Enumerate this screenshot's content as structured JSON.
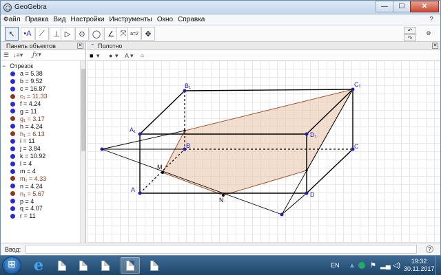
{
  "window": {
    "title": "GeoGebra"
  },
  "window_controls": {
    "minimize": "—",
    "maximize": "☐",
    "close": "✕"
  },
  "menu": [
    "Файл",
    "Правка",
    "Вид",
    "Настройки",
    "Инструменты",
    "Окно",
    "Справка"
  ],
  "menu_help": "?",
  "toolbar": {
    "tools": [
      {
        "name": "move-tool",
        "glyph": "↖",
        "active": true
      },
      {
        "name": "point-tool",
        "glyph": "•A"
      },
      {
        "name": "line-tool",
        "glyph": "⟋"
      },
      {
        "name": "perpendicular-tool",
        "glyph": "⊥"
      },
      {
        "name": "polygon-tool",
        "glyph": "▷"
      },
      {
        "name": "circle-tool",
        "glyph": "⊙"
      },
      {
        "name": "circle-arc-tool",
        "glyph": "◯"
      },
      {
        "name": "angle-tool",
        "glyph": "∠"
      },
      {
        "name": "reflect-tool",
        "glyph": "⤧"
      },
      {
        "name": "slider-tool",
        "glyph": "a=2"
      },
      {
        "name": "move-graphics-tool",
        "glyph": "✥"
      }
    ],
    "undo": "↶",
    "redo": "↷",
    "settings": "⚙"
  },
  "algebra": {
    "title": "Панель объектов",
    "group": "Отрезок",
    "items": [
      {
        "label": "a = 5.38",
        "color": "#2a2ad4",
        "text_color": "#111"
      },
      {
        "label": "b = 9.52",
        "color": "#2a2ad4",
        "text_color": "#111"
      },
      {
        "label": "c = 16.87",
        "color": "#2a2ad4",
        "text_color": "#111"
      },
      {
        "label": "c₁ = 11.33",
        "color": "#8b3a1f",
        "text_color": "#8b3a1f"
      },
      {
        "label": "f = 4.24",
        "color": "#2a2ad4",
        "text_color": "#111"
      },
      {
        "label": "g = 11",
        "color": "#2a2ad4",
        "text_color": "#111"
      },
      {
        "label": "g₁ = 3.17",
        "color": "#8b3a1f",
        "text_color": "#8b3a1f"
      },
      {
        "label": "h = 4.24",
        "color": "#2a2ad4",
        "text_color": "#111"
      },
      {
        "label": "h₁ = 6.13",
        "color": "#8b3a1f",
        "text_color": "#8b3a1f"
      },
      {
        "label": "i = 11",
        "color": "#2a2ad4",
        "text_color": "#111"
      },
      {
        "label": "j = 3.84",
        "color": "#2a2ad4",
        "text_color": "#111"
      },
      {
        "label": "k = 10.92",
        "color": "#2a2ad4",
        "text_color": "#111"
      },
      {
        "label": "l = 4",
        "color": "#2a2ad4",
        "text_color": "#111"
      },
      {
        "label": "m = 4",
        "color": "#2a2ad4",
        "text_color": "#111"
      },
      {
        "label": "m₁ = 4.33",
        "color": "#8b3a1f",
        "text_color": "#8b3a1f"
      },
      {
        "label": "n = 4.24",
        "color": "#2a2ad4",
        "text_color": "#111"
      },
      {
        "label": "n₁ = 5.67",
        "color": "#8b3a1f",
        "text_color": "#8b3a1f"
      },
      {
        "label": "p = 4",
        "color": "#2a2ad4",
        "text_color": "#111"
      },
      {
        "label": "q = 4.07",
        "color": "#2a2ad4",
        "text_color": "#111"
      },
      {
        "label": "r = 11",
        "color": "#2a2ad4",
        "text_color": "#111"
      }
    ]
  },
  "graphics": {
    "title": "Полотно",
    "style_bar": [
      "■",
      "▾",
      "●",
      "▾",
      "A",
      "▾",
      "🔓"
    ],
    "point_labels": {
      "B1": "B₁",
      "C1": "C₁",
      "A1": "A₁",
      "D1": "D₁",
      "B": "B",
      "C": "C",
      "A": "A",
      "D": "D",
      "M": "M",
      "N": "N"
    }
  },
  "input_bar": {
    "label": "Ввод:",
    "value": "",
    "help": "?"
  },
  "taskbar": {
    "language": "EN",
    "time": "19:32",
    "date": "30.11.2017"
  }
}
